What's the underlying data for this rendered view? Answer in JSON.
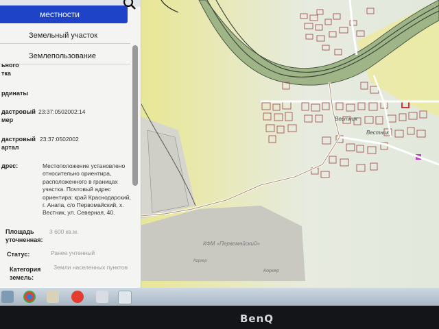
{
  "search": {
    "selected": "местности"
  },
  "object_types": [
    "Земельный участок",
    "Землепользование"
  ],
  "fields": {
    "frag1": "ьного",
    "frag2": "тка",
    "coords_label": "рдинаты",
    "cad_num_label_1": "дастровый",
    "cad_num_label_2": "мер",
    "cad_num_value": "23:37:0502002:14",
    "cad_q_label_1": "дастровый",
    "cad_q_label_2": "артал",
    "cad_q_value": "23:37:0502002",
    "addr_label": "дрес:",
    "addr_value": [
      "Местоположение установлено",
      "относительно ориентира,",
      "расположенного в границах",
      "участка. Почтовый адрес",
      "ориентира: край Краснодарский,",
      "г. Анапа, с/о Первомайский, х.",
      "Вестник, ул. Северная, 40."
    ],
    "area_label_1": "Площадь",
    "area_label_2": "уточненная:",
    "area_value": "3 600 кв.м.",
    "status_label": "Статус:",
    "status_value": "Ранее учтенный",
    "cat_label_1": "Категория",
    "cat_label_2": "земель:",
    "cat_value": "Земли населенных пунктов"
  },
  "map_labels": {
    "place1": "Вестник",
    "place2": "Вестник",
    "farm": "КФМ «Первомайский»",
    "bottom1": "Коркер",
    "bottom2": "Коркер"
  },
  "brand": "BenQ"
}
